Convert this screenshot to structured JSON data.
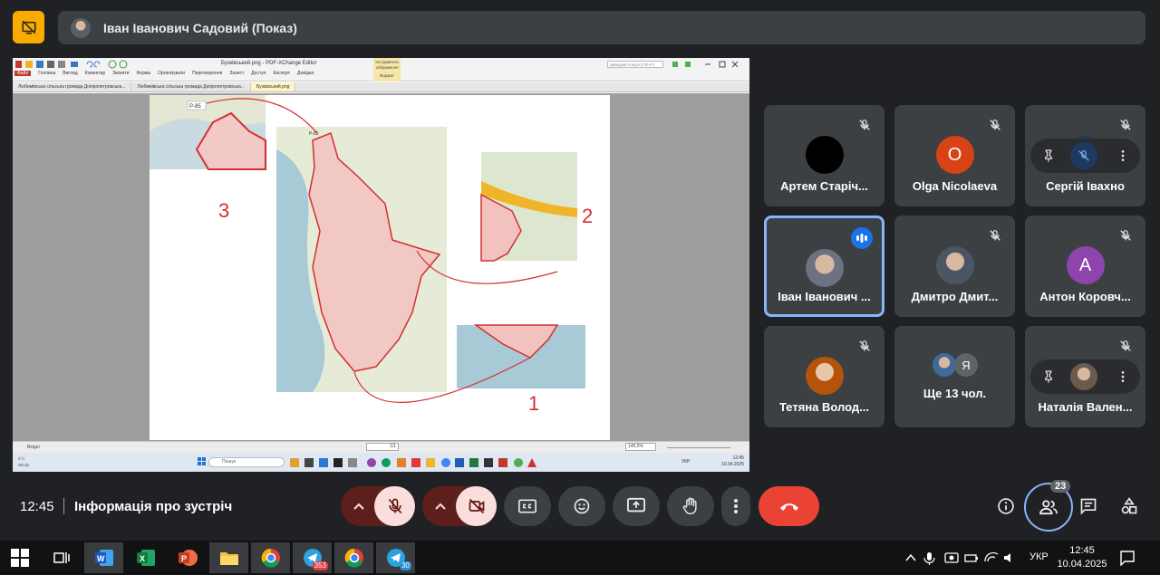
{
  "presenter": {
    "name": "Іван Іванович Садовий (Показ)"
  },
  "shared_screen": {
    "window_title": "Бузківський.png - PDF-XChange Editor",
    "search_placeholder": "Швидкий пошук (Ctrl+F)",
    "special_tab": "Інструменти зображення",
    "special_tab_sub": "Формат",
    "menu": [
      "Файл",
      "Головна",
      "Вигляд",
      "Коментар",
      "Змінити",
      "Форма",
      "Організувати",
      "Перетворення",
      "Захист",
      "Доступ",
      "Експорт",
      "Довідка"
    ],
    "tabs": [
      "Любимівська сільська громада Дніпропетровська...",
      "Любимівська сільська громада Дніпропетровська...",
      "Бузківський.png"
    ],
    "map": {
      "road_label": "P-85",
      "labels": [
        "1",
        "2",
        "3"
      ]
    },
    "status": {
      "page": "1/1",
      "zoom": "149,5%",
      "left_text": "Вхідні"
    },
    "taskbar": {
      "search": "Пошук",
      "lang": "УКР",
      "time": "12:45",
      "date": "10.04.2025",
      "weather_temp": "4°C",
      "weather_desc": "Windy"
    }
  },
  "participants": [
    {
      "name": "Артем Старіч...",
      "avatar_color": "#000000",
      "initial": "",
      "muted": true
    },
    {
      "name": "Olga Nicolaeva",
      "avatar_color": "#d84315",
      "initial": "O",
      "muted": true
    },
    {
      "name": "Сергій Івахно",
      "avatar_color": "#1e3a5f",
      "initial": "",
      "muted": true,
      "hovered": true
    },
    {
      "name": "Іван Іванович ...",
      "avatar_color": "#6b7280",
      "initial": "",
      "muted": false,
      "speaking": true
    },
    {
      "name": "Дмитро Дмит...",
      "avatar_color": "#4b5563",
      "initial": "",
      "muted": true
    },
    {
      "name": "Антон Коровч...",
      "avatar_color": "#8e44ad",
      "initial": "A",
      "muted": true
    },
    {
      "name": "Тетяна Волод...",
      "avatar_color": "#b45309",
      "initial": "",
      "muted": true
    },
    {
      "name": "Ще 13 чол.",
      "avatar_color": "#5f6368",
      "initial": "Я",
      "muted": false
    },
    {
      "name": "Наталія Вален...",
      "avatar_color": "#6b5b4e",
      "initial": "",
      "muted": true,
      "hovered": true
    }
  ],
  "meeting": {
    "time": "12:45",
    "info_label": "Інформація про зустріч",
    "people_count": "23"
  },
  "windows_taskbar": {
    "lang": "УКР",
    "time": "12:45",
    "date": "10.04.2025",
    "telegram_badge_1": "353",
    "telegram_badge_2": "30"
  },
  "colors": {
    "accent": "#8ab4f8",
    "hangup": "#ea4335",
    "present": "#f9ab00",
    "mic_off_bg": "#f9dedc"
  }
}
